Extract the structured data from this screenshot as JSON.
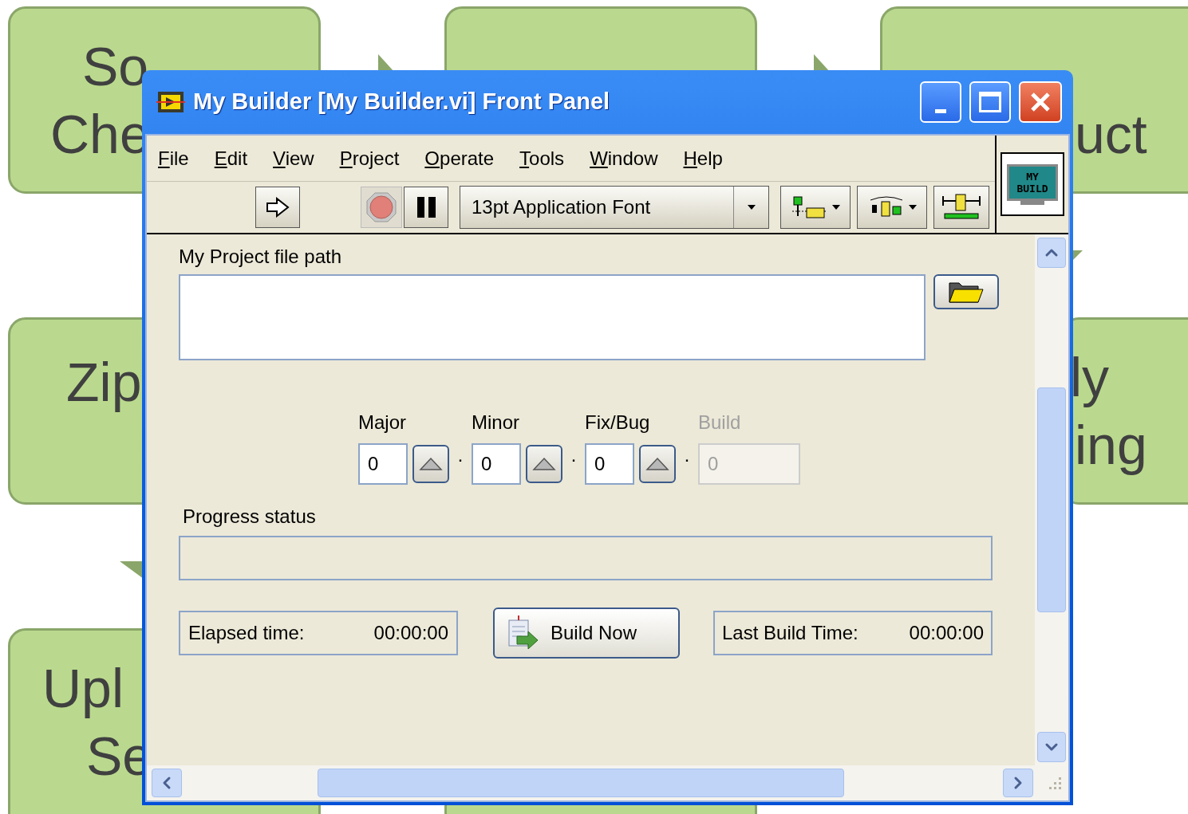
{
  "diagram": {
    "nodes": [
      {
        "lines": [
          "So",
          "Che"
        ]
      },
      {
        "lines": [
          "uct"
        ]
      },
      {
        "lines": [
          "Zip"
        ]
      },
      {
        "lines": [
          "ly",
          "ing"
        ]
      },
      {
        "lines": [
          "Upl",
          "Se"
        ]
      }
    ]
  },
  "window": {
    "title": "My Builder [My Builder.vi] Front Panel",
    "menu": [
      "File",
      "Edit",
      "View",
      "Project",
      "Operate",
      "Tools",
      "Window",
      "Help"
    ],
    "toolbar": {
      "font": "13pt Application Font"
    },
    "vi_icon": {
      "lines": [
        "MY",
        "BUILD"
      ]
    },
    "path": {
      "label": "My Project file path"
    },
    "version": {
      "separator": "·",
      "fields": [
        {
          "label": "Major",
          "value": "0",
          "disabled": false
        },
        {
          "label": "Minor",
          "value": "0",
          "disabled": false
        },
        {
          "label": "Fix/Bug",
          "value": "0",
          "disabled": false
        },
        {
          "label": "Build",
          "value": "0",
          "disabled": true
        }
      ]
    },
    "progress": {
      "label": "Progress status"
    },
    "elapsed": {
      "label": "Elapsed time:",
      "value": "00:00:00"
    },
    "build_button": "Build Now",
    "last_build": {
      "label": "Last Build Time:",
      "value": "00:00:00"
    }
  }
}
